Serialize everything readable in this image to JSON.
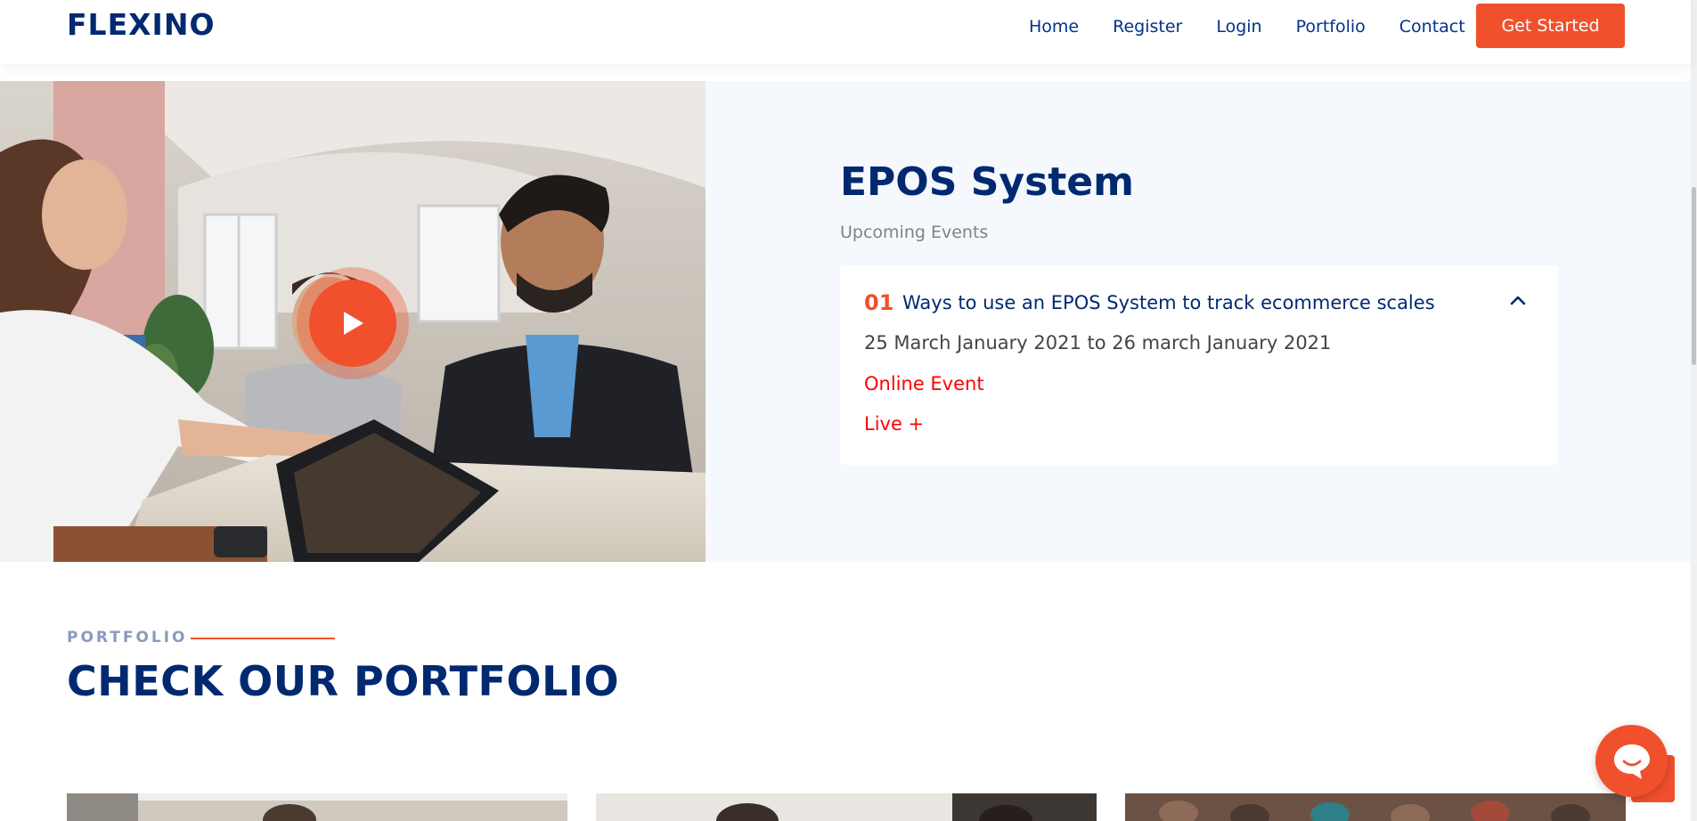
{
  "header": {
    "logo": "FLEXINO",
    "nav": [
      "Home",
      "Register",
      "Login",
      "Portfolio",
      "Contact"
    ],
    "cta_label": "Get Started"
  },
  "event": {
    "title": "EPOS System",
    "subtitle": "Upcoming Events",
    "number": "01",
    "name": "Ways to use an EPOS System to track ecommerce scales",
    "dates": "25 March January 2021 to 26 march January 2021",
    "type": "Online Event",
    "live": "Live +"
  },
  "portfolio": {
    "label": "PORTFOLIO",
    "title": "CHECK OUR PORTFOLIO"
  },
  "colors": {
    "accent": "#f0502c",
    "navy": "#012970",
    "section_bg": "#f5f8fd",
    "event_red": "#ff0000"
  },
  "icons": {
    "play": "play-icon",
    "chevron": "chevron-up-icon",
    "chat": "chat-icon",
    "back_to_top": "arrow-up-icon"
  }
}
